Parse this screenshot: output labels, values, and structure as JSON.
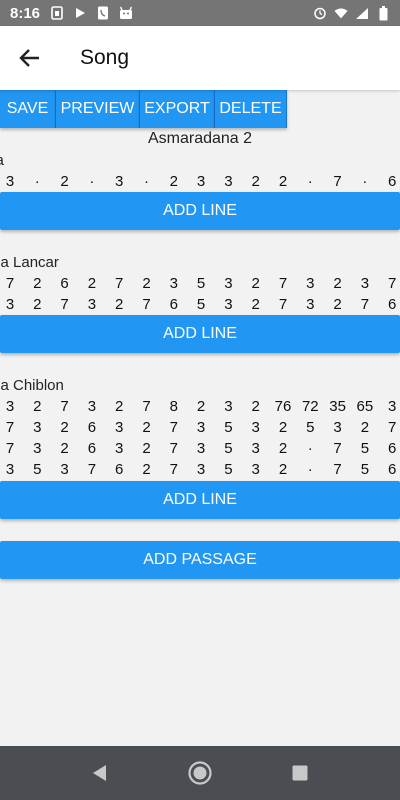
{
  "status_bar": {
    "time": "8:16"
  },
  "app_bar": {
    "title": "Song"
  },
  "toolbar": {
    "save": "SAVE",
    "preview": "PREVIEW",
    "export": "EXPORT",
    "delete": "DELETE"
  },
  "song": {
    "title": "Asmaradana 2"
  },
  "passages": [
    {
      "name": "ka",
      "lines": [
        [
          "3",
          "·",
          "2",
          "·",
          "3",
          "·",
          "2",
          "3",
          "3",
          "2",
          "2",
          "·",
          "7",
          "·",
          "6"
        ]
      ],
      "add_line_label": "ADD LINE"
    },
    {
      "name": "ma Lancar",
      "lines": [
        [
          "7",
          "2",
          "6",
          "2",
          "7",
          "2",
          "3",
          "5",
          "3",
          "2",
          "7",
          "3",
          "2",
          "3",
          "7"
        ],
        [
          "3",
          "2",
          "7",
          "3",
          "2",
          "7",
          "6",
          "5",
          "3",
          "2",
          "7",
          "3",
          "2",
          "7",
          "6"
        ]
      ],
      "add_line_label": "ADD LINE"
    },
    {
      "name": "ma Chiblon",
      "lines": [
        [
          "3",
          "2",
          "7",
          "3",
          "2",
          "7",
          "8",
          "2",
          "3",
          "2",
          "76",
          "72",
          "35",
          "65",
          "3"
        ],
        [
          "7",
          "3",
          "2",
          "6",
          "3",
          "2",
          "7",
          "3",
          "5",
          "3",
          "2",
          "5",
          "3",
          "2",
          "7"
        ],
        [
          "7",
          "3",
          "2",
          "6",
          "3",
          "2",
          "7",
          "3",
          "5",
          "3",
          "2",
          "·",
          "7",
          "5",
          "6"
        ],
        [
          "3",
          "5",
          "3",
          "7",
          "6",
          "2",
          "7",
          "3",
          "5",
          "3",
          "2",
          "·",
          "7",
          "5",
          "6"
        ]
      ],
      "add_line_label": "ADD LINE"
    }
  ],
  "add_passage_label": "ADD PASSAGE"
}
